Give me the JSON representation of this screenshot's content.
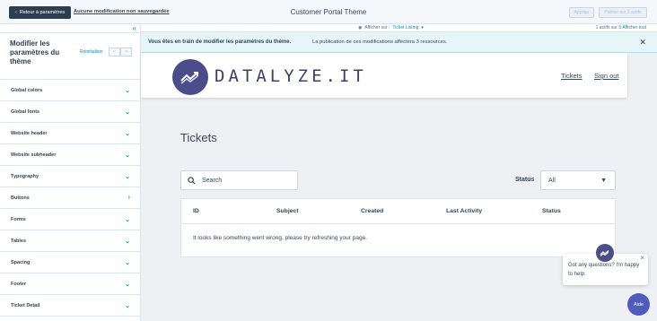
{
  "topbar": {
    "back_label": "Retour à paramètres",
    "unsaved_label": "Aucune modification non sauvegardée",
    "title": "Customer Portal Theme",
    "apply_label": "Appliqu",
    "publish_label": "Publier sur 3 actifs"
  },
  "subbar": {
    "view_on_label": "Afficher sur :",
    "view_on_value": "Ticket Listing",
    "active_count": "1 actifs sur 3",
    "show_all_label": "Afficher tout"
  },
  "sidebar": {
    "title": "Modifier les paramètres du thème",
    "reset_label": "Réinitialiser",
    "items": [
      {
        "label": "Global colors",
        "chev": "⌄"
      },
      {
        "label": "Global fonts",
        "chev": "⌄"
      },
      {
        "label": "Website header",
        "chev": "⌄"
      },
      {
        "label": "Website subheader",
        "chev": "⌄"
      },
      {
        "label": "Typography",
        "chev": "⌄"
      },
      {
        "label": "Buttons",
        "chev": "›"
      },
      {
        "label": "Forms",
        "chev": "⌄"
      },
      {
        "label": "Tables",
        "chev": "⌄"
      },
      {
        "label": "Spacing",
        "chev": "⌄"
      },
      {
        "label": "Footer",
        "chev": "⌄"
      },
      {
        "label": "Ticket Detail",
        "chev": "⌄"
      }
    ]
  },
  "notice": {
    "bold_text": "Vous êtes en train de modifier les paramètres du thème.",
    "text": "La publication de ces modifications affectera 3 ressources."
  },
  "site": {
    "logo_text": "DATALYZE.IT",
    "nav": [
      "Tickets",
      "Sign out"
    ],
    "page_title": "Tickets",
    "search_placeholder": "Search",
    "status_label": "Status",
    "status_value": "All",
    "columns": [
      "ID",
      "Subject",
      "Created",
      "Last Activity",
      "Status"
    ],
    "empty_message": "It looks like something went wrong, please try refreshing your page."
  },
  "chat": {
    "message": "Got any questions? I'm happy to help.",
    "button_label": "Aide"
  },
  "colors": {
    "brand": "#4a4d8a",
    "accent": "#0091ae",
    "dark": "#2d3e50"
  }
}
